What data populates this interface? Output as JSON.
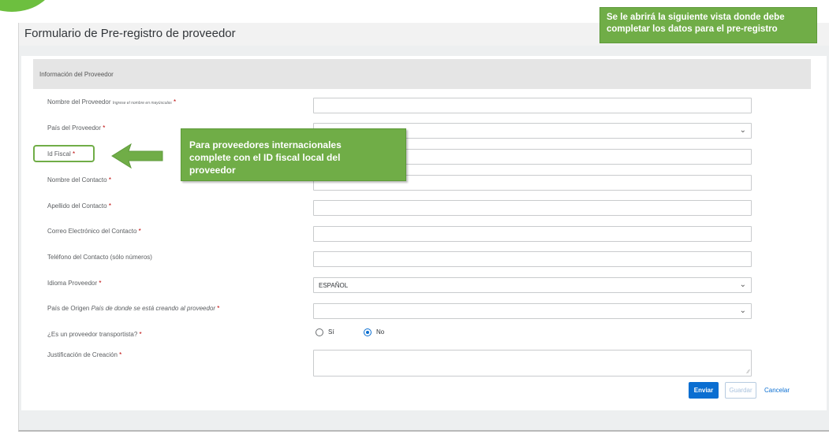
{
  "page": {
    "title": "Formulario de Pre-registro de proveedor"
  },
  "section": {
    "title": "Información del Proveedor"
  },
  "fields": [
    {
      "label": "Nombre del Proveedor",
      "hint": "Ingrese el nombre en mayúsculas",
      "required": "*",
      "type": "text",
      "value": ""
    },
    {
      "label": "País del Proveedor",
      "required": "*",
      "type": "select",
      "value": ""
    },
    {
      "label": "Id Fiscal",
      "required": "*",
      "type": "text",
      "value": ""
    },
    {
      "label": "Nombre del Contacto",
      "required": "*",
      "type": "text",
      "value": ""
    },
    {
      "label": "Apellido del Contacto",
      "required": "*",
      "type": "text",
      "value": ""
    },
    {
      "label": "Correo Electrónico del Contacto",
      "required": "*",
      "type": "text",
      "value": ""
    },
    {
      "label": "Teléfono del Contacto (sólo números)",
      "type": "text",
      "value": ""
    },
    {
      "label": "Idioma Proveedor",
      "required": "*",
      "type": "select",
      "value": "ESPAÑOL"
    },
    {
      "label": "País de Origen",
      "hint": "País de donde se está creando al proveedor",
      "required": "*",
      "type": "select",
      "value": ""
    },
    {
      "label": "¿Es un proveedor transportista?",
      "required": "*",
      "type": "radio",
      "options": [
        "Sí",
        "No"
      ],
      "selected": "No"
    },
    {
      "label": "Justificación de Creación",
      "required": "*",
      "type": "textarea",
      "value": ""
    }
  ],
  "buttons": {
    "submit": "Enviar",
    "save": "Guardar",
    "cancel": "Cancelar"
  },
  "callouts": {
    "top_line1": "Se le abrirá la siguiente vista donde debe",
    "top_line2": "completar los datos para el pre-registro",
    "mid_line1": "Para proveedores internacionales",
    "mid_line2": "complete con el ID fiscal local del",
    "mid_line3": "proveedor"
  },
  "colors": {
    "accent": "#0a6ed1",
    "callout": "#70ad47",
    "required": "#bb0000"
  },
  "icons": {
    "select_chevron": "chevron-down-icon",
    "arrow": "arrow-left-icon"
  }
}
